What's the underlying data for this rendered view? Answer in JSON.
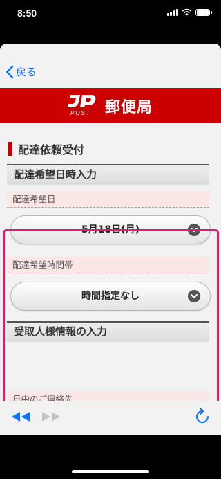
{
  "status_bar": {
    "time": "8:50"
  },
  "nav": {
    "back_label": "戻る"
  },
  "header": {
    "logo_text": "JP POST",
    "title": "郵便局"
  },
  "form": {
    "section_heading": "配達依頼受付",
    "delivery_heading": "配達希望日時入力",
    "date_label": "配達希望日",
    "date_value": "5月18日(月)",
    "time_label": "配達希望時間帯",
    "time_value": "時間指定なし",
    "recipient_heading": "受取人様情報の入力",
    "contact_label": "日中のご連絡先",
    "contact_value": ""
  },
  "toolbar": {
    "back_icon": "rewind-icon",
    "forward_icon": "fast-forward-icon",
    "reload_icon": "reload-icon"
  },
  "colors": {
    "header_red": "#cc0000",
    "highlight_pink": "#e8196b",
    "link_blue": "#0a74ff"
  }
}
